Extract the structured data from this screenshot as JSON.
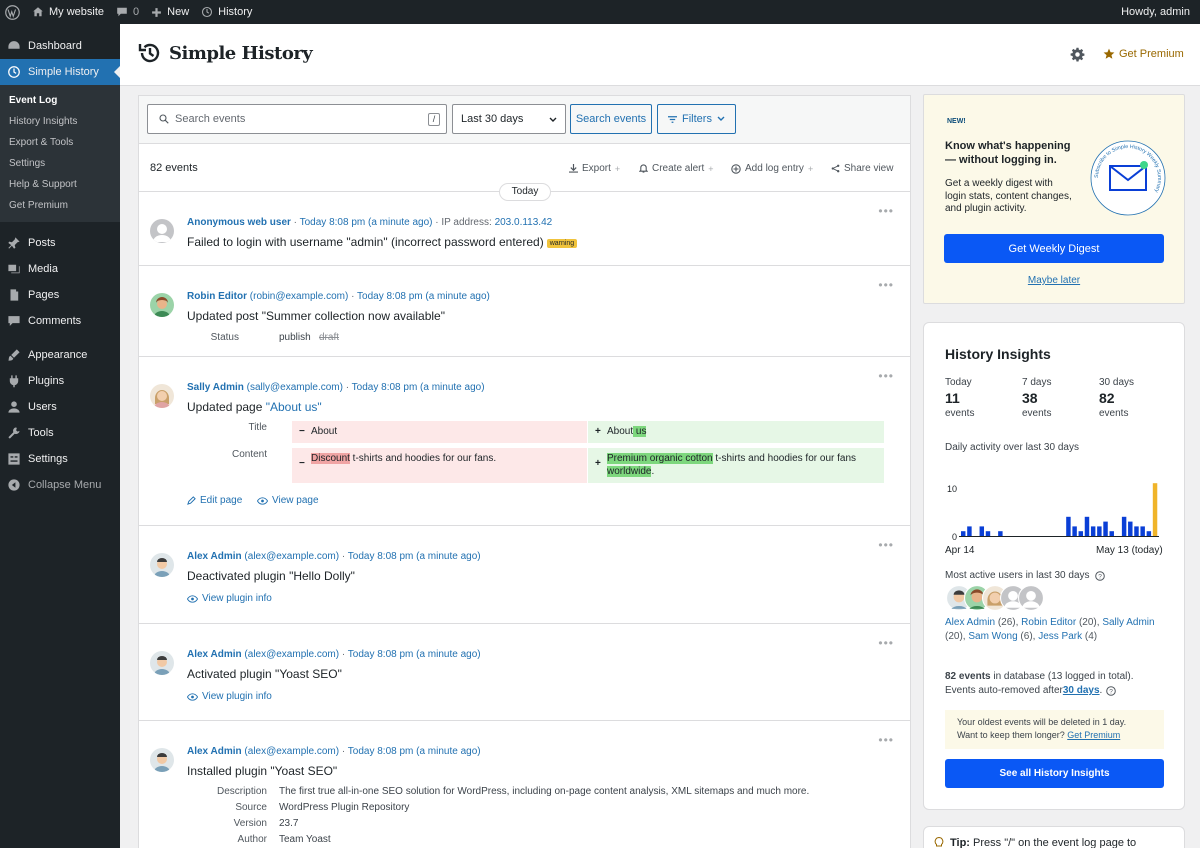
{
  "adminbar": {
    "site": "My website",
    "comments": "0",
    "new": "New",
    "history": "History",
    "howdy": "Howdy, admin"
  },
  "sidebar": {
    "items": [
      {
        "label": "Dashboard",
        "icon": "dashboard-icon"
      },
      {
        "label": "Simple History",
        "icon": "history-icon"
      }
    ],
    "submenu": [
      "Event Log",
      "History Insights",
      "Export & Tools",
      "Settings",
      "Help & Support",
      "Get Premium"
    ],
    "items2": [
      {
        "label": "Posts",
        "icon": "pin-icon"
      },
      {
        "label": "Media",
        "icon": "media-icon"
      },
      {
        "label": "Pages",
        "icon": "pages-icon"
      },
      {
        "label": "Comments",
        "icon": "comments-icon"
      }
    ],
    "items3": [
      {
        "label": "Appearance",
        "icon": "brush-icon"
      },
      {
        "label": "Plugins",
        "icon": "plugin-icon"
      },
      {
        "label": "Users",
        "icon": "users-icon"
      },
      {
        "label": "Tools",
        "icon": "wrench-icon"
      },
      {
        "label": "Settings",
        "icon": "settings-icon"
      },
      {
        "label": "Collapse Menu",
        "icon": "collapse-icon"
      }
    ]
  },
  "header": {
    "title": "Simple History",
    "premium": "Get Premium"
  },
  "toolbar": {
    "search_placeholder": "Search events",
    "slash": "/",
    "daterange": "Last 30 days",
    "search_btn": "Search events",
    "filters": "Filters"
  },
  "toolbar2": {
    "count": "82 events",
    "export": "Export",
    "alert": "Create alert",
    "add": "Add log entry",
    "share": "Share view",
    "today": "Today"
  },
  "events": [
    {
      "who": "Anonymous web user",
      "when": "Today 8:08 pm (a minute ago)",
      "ip_label": "· IP address:",
      "ip": "203.0.113.42",
      "msg": "Failed to login with username \"admin\" (incorrect password entered)",
      "badge": "warning"
    },
    {
      "who": "Robin Editor",
      "email": "(robin@example.com)",
      "when": "Today 8:08 pm (a minute ago)",
      "msg": "Updated post \"Summer collection now available\"",
      "k1": "Status",
      "v1": "publish",
      "v1old": "draft"
    },
    {
      "who": "Sally Admin",
      "email": "(sally@example.com)",
      "when": "Today 8:08 pm (a minute ago)",
      "msg": "Updated page ",
      "msg_link": "\"About us\"",
      "k1": "Title",
      "k2": "Content",
      "t_old": "About",
      "t_new": "About",
      "t_new_hl": " us",
      "c_old_hl": "Discount",
      "c_old": " t-shirts and hoodies for our fans.",
      "c_new_hl": "Premium organic cotton",
      "c_new": " t-shirts and hoodies for our fans",
      "c_new_hl2": "worldwide",
      "c_new_end": ".",
      "l1": "Edit page",
      "l2": "View page"
    },
    {
      "who": "Alex Admin",
      "email": "(alex@example.com)",
      "when": "Today 8:08 pm (a minute ago)",
      "msg": "Deactivated plugin \"Hello Dolly\"",
      "l1": "View plugin info"
    },
    {
      "who": "Alex Admin",
      "email": "(alex@example.com)",
      "when": "Today 8:08 pm (a minute ago)",
      "msg": "Activated plugin \"Yoast SEO\"",
      "l1": "View plugin info"
    },
    {
      "who": "Alex Admin",
      "email": "(alex@example.com)",
      "when": "Today 8:08 pm (a minute ago)",
      "msg": "Installed plugin \"Yoast SEO\"",
      "k1": "Description",
      "v1": "The first true all-in-one SEO solution for WordPress, including on-page content analysis, XML sitemaps and much more.",
      "k2": "Source",
      "v2": "WordPress Plugin Repository",
      "k3": "Version",
      "v3": "23.7",
      "k4": "Author",
      "v4": "Team Yoast"
    }
  ],
  "promo": {
    "badge": "NEW!",
    "title1": "Know what's happening",
    "title2": "— without logging in.",
    "body1": "Get a weekly digest with",
    "body2": "login stats, content changes,",
    "body3": "and plugin activity.",
    "seal_text": "Subscribe to Simple History Weekly Summary",
    "btn": "Get Weekly Digest",
    "later": "Maybe later"
  },
  "insights": {
    "title": "History Insights",
    "stats": [
      {
        "label": "Today",
        "value": "11",
        "unit": "events"
      },
      {
        "label": "7 days",
        "value": "38",
        "unit": "events"
      },
      {
        "label": "30 days",
        "value": "82",
        "unit": "events"
      }
    ],
    "chart_title": "Daily activity over last 30 days",
    "chart_data": {
      "type": "bar",
      "title": "Daily activity over last 30 days",
      "ylim": [
        0,
        10
      ],
      "yticks": [
        "10",
        "0"
      ],
      "x_start": "Apr 14",
      "x_end": "May 13 (today)",
      "values": [
        1,
        2,
        0,
        2,
        1,
        0,
        1,
        0,
        0,
        0,
        0,
        0,
        0,
        0,
        0,
        0,
        0,
        4,
        2,
        1,
        4,
        2,
        2,
        3,
        1,
        0,
        4,
        3,
        2,
        2,
        1,
        11
      ],
      "accent": "#0a3fd6",
      "today_color": "#f0b429"
    },
    "users_title": "Most active users in last 30 days",
    "users": [
      {
        "name": "Alex Admin",
        "count": "(26),"
      },
      {
        "name": "Robin Editor",
        "count": "(20),"
      },
      {
        "name": "Sally Admin",
        "count": "(20),"
      },
      {
        "name": "Sam Wong",
        "count": "(6),"
      },
      {
        "name": "Jess Park",
        "count": "(4)"
      }
    ],
    "db1_bold": "82 events",
    "db1": " in database (13 logged in total).",
    "db2": "Events auto-removed after ",
    "db2_link": "30 days",
    "db2_end": ".",
    "notice1": "Your oldest events will be deleted in 1 day.",
    "notice2": "Want to keep them longer? ",
    "notice_link": "Get Premium",
    "btn": "See all History Insights"
  },
  "tip": {
    "label": "Tip:",
    "text": " Press \"/\" on the event log page to"
  }
}
